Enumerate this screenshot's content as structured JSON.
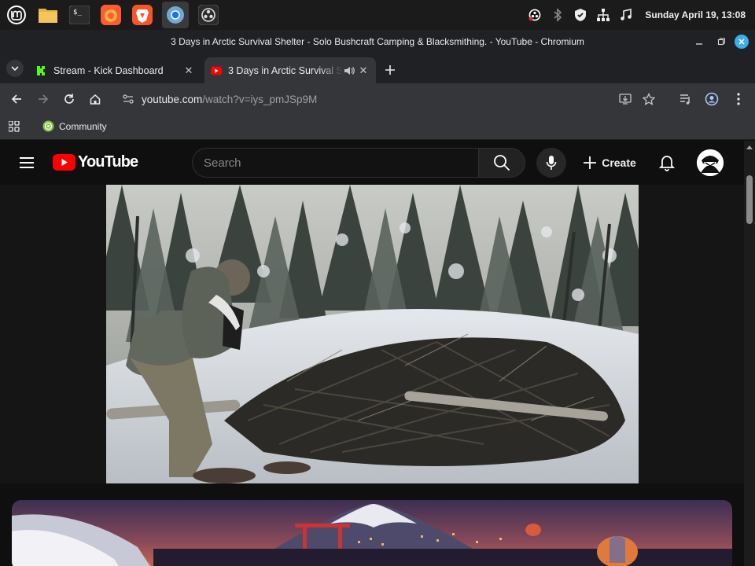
{
  "taskbar": {
    "apps": [
      {
        "name": "linux-mint-menu-icon"
      },
      {
        "name": "files-icon"
      },
      {
        "name": "terminal-icon"
      },
      {
        "name": "firefox-icon"
      },
      {
        "name": "brave-icon"
      },
      {
        "name": "chromium-icon"
      },
      {
        "name": "obs-icon"
      }
    ],
    "clock": "Sunday April 19, 13:08"
  },
  "window": {
    "title": "3 Days in Arctic Survival Shelter - Solo Bushcraft Camping & Blacksmithing. - YouTube - Chromium"
  },
  "tabs": [
    {
      "label": "Stream - Kick Dashboard",
      "favicon": "kick-icon",
      "active": false
    },
    {
      "label": "3 Days in Arctic Survival Shelter - Solo Bushcraft Camping & Blacksmithing.",
      "favicon": "youtube-icon",
      "active": true
    }
  ],
  "address_bar": {
    "host": "youtube.com",
    "path": "/watch?v=iys_pmJSp9M"
  },
  "bookmarks": [
    {
      "label": "Community"
    }
  ],
  "youtube": {
    "logo_text": "YouTube",
    "search_placeholder": "Search",
    "create_label": "Create"
  },
  "colors": {
    "youtube_red": "#ff0000",
    "kick_green": "#53fc18",
    "close_blue": "#3daee9",
    "page_bg": "#0f0f0f"
  }
}
